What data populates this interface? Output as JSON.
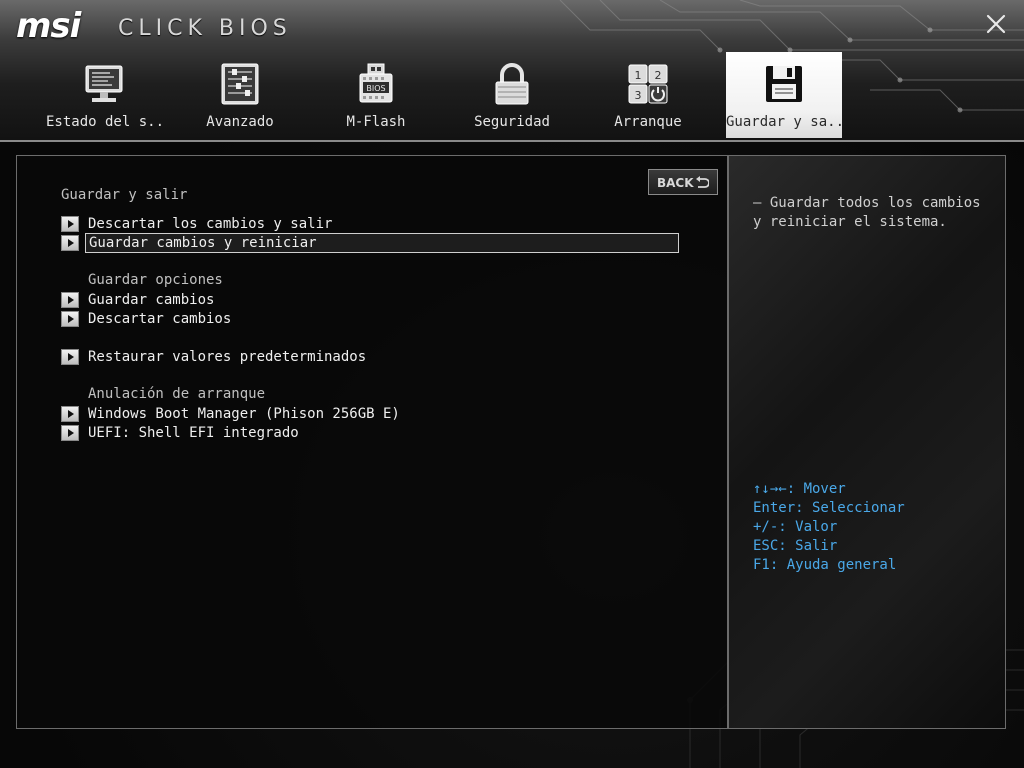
{
  "header": {
    "logo_brand": "msi",
    "logo_product": "CLICK BIOS",
    "close_label": "×"
  },
  "tabs": [
    {
      "label": "Estado del s..",
      "icon": "monitor-icon"
    },
    {
      "label": "Avanzado",
      "icon": "sliders-icon"
    },
    {
      "label": "M-Flash",
      "icon": "usb-bios-icon",
      "badge": "BIOS"
    },
    {
      "label": "Seguridad",
      "icon": "lock-icon"
    },
    {
      "label": "Arranque",
      "icon": "boot-order-icon",
      "digits": [
        "1",
        "2",
        "3"
      ]
    },
    {
      "label": "Guardar y sa..",
      "icon": "floppy-disk-icon",
      "active": true
    }
  ],
  "main": {
    "back_label": "BACK",
    "page_title": "Guardar y salir",
    "items_top": [
      {
        "label": "Descartar los cambios y salir"
      },
      {
        "label": "Guardar cambios y reiniciar",
        "selected": true
      }
    ],
    "save_options_title": "Guardar opciones",
    "items_save": [
      {
        "label": "Guardar cambios"
      },
      {
        "label": "Descartar cambios"
      }
    ],
    "items_restore": [
      {
        "label": "Restaurar valores predeterminados"
      }
    ],
    "boot_override_title": "Anulación de arranque",
    "items_boot": [
      {
        "label": "Windows Boot Manager (Phison 256GB E)"
      },
      {
        "label": "UEFI: Shell EFI integrado"
      }
    ]
  },
  "help": {
    "lines": [
      "– Guardar todos los cambios",
      "y reiniciar el sistema."
    ],
    "keys": [
      "↑↓→←: Mover",
      "Enter: Seleccionar",
      "+/-: Valor",
      "ESC: Salir",
      "F1: Ayuda general"
    ]
  },
  "colors": {
    "key_hint": "#4aa8e8",
    "active_tab": "#f1f1f1"
  }
}
